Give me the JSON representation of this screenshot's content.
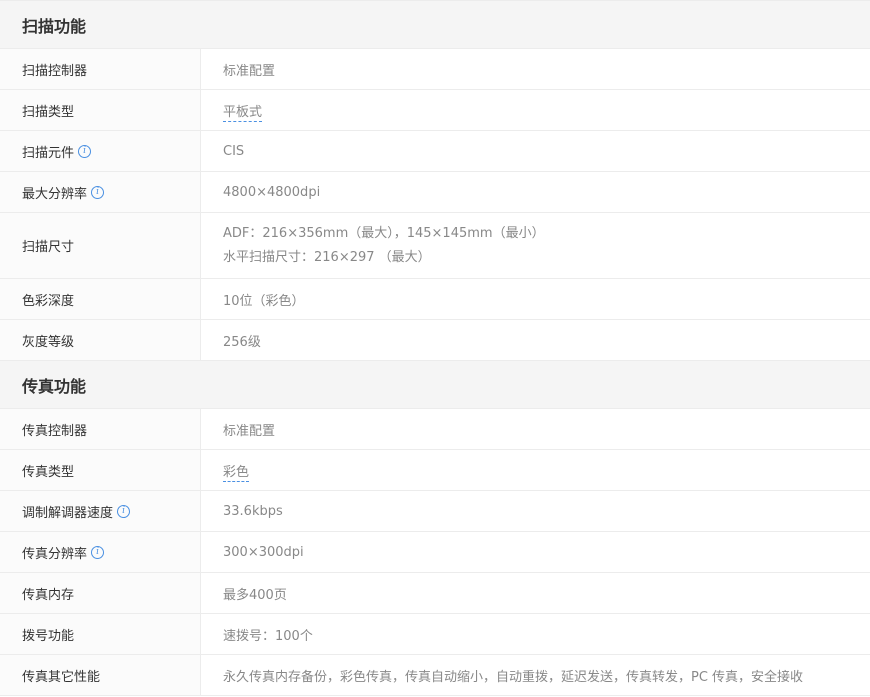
{
  "sections": [
    {
      "title": "扫描功能",
      "rows": [
        {
          "label": "扫描控制器",
          "value": "标准配置"
        },
        {
          "label": "扫描类型",
          "value": "平板式"
        },
        {
          "label": "扫描元件",
          "value": "CIS"
        },
        {
          "label": "最大分辨率",
          "value": "4800×4800dpi"
        },
        {
          "label": "扫描尺寸",
          "value_line1": "ADF：216×356mm（最大），145×145mm（最小）",
          "value_line2": "水平扫描尺寸：216×297 （最大）"
        },
        {
          "label": "色彩深度",
          "value": "10位（彩色）"
        },
        {
          "label": "灰度等级",
          "value": "256级"
        }
      ]
    },
    {
      "title": "传真功能",
      "rows": [
        {
          "label": "传真控制器",
          "value": "标准配置"
        },
        {
          "label": "传真类型",
          "value": "彩色"
        },
        {
          "label": "调制解调器速度",
          "value": "33.6kbps"
        },
        {
          "label": "传真分辨率",
          "value": "300×300dpi"
        },
        {
          "label": "传真内存",
          "value": "最多400页"
        },
        {
          "label": "拨号功能",
          "value": "速拨号：100个"
        },
        {
          "label": "传真其它性能",
          "value": "永久传真内存备份，彩色传真，传真自动缩小，自动重拨，延迟发送，传真转发，PC 传真，安全接收"
        }
      ]
    }
  ],
  "info_icon_glyph": "i",
  "colors": {
    "link": "#4a90e2",
    "header_bg": "#f5f5f5",
    "value_text": "#888888"
  }
}
